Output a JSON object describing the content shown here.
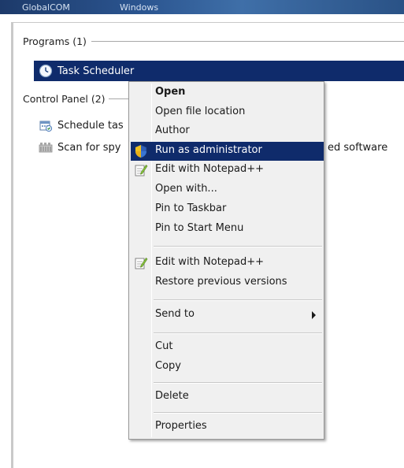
{
  "taskbar": {
    "item1": "GlobalCOM",
    "item2": "Windows"
  },
  "programs": {
    "header": "Programs (1)",
    "items": [
      {
        "label": "Task Scheduler",
        "icon": "clock-icon",
        "selected": true
      }
    ]
  },
  "control_panel": {
    "header": "Control Panel (2)",
    "items": [
      {
        "label": "Schedule tasks",
        "visible_prefix": "Schedule tas",
        "icon": "schedule-tasks-icon"
      },
      {
        "label": "Scan for spyware and other potentially unwanted software",
        "visible_prefix": "Scan for spy",
        "visible_suffix": "ed software",
        "icon": "defender-icon"
      }
    ]
  },
  "context_menu": {
    "items": [
      {
        "label": "Open",
        "bold": true
      },
      {
        "label": "Open file location"
      },
      {
        "label": "Author"
      },
      {
        "label": "Run as administrator",
        "icon": "uac-shield-icon",
        "highlighted": true
      },
      {
        "label": "Edit with Notepad++",
        "icon": "notepadpp-icon"
      },
      {
        "label": "Open with..."
      },
      {
        "label": "Pin to Taskbar"
      },
      {
        "label": "Pin to Start Menu"
      },
      {
        "label": "Edit with Notepad++",
        "icon": "notepadpp-icon"
      },
      {
        "label": "Restore previous versions"
      },
      {
        "label": "Send to",
        "submenu": true
      },
      {
        "label": "Cut"
      },
      {
        "label": "Copy"
      },
      {
        "label": "Delete"
      },
      {
        "label": "Properties"
      }
    ]
  },
  "colors": {
    "selection": "#0f2b6b",
    "menu_bg": "#f0f0f0"
  }
}
